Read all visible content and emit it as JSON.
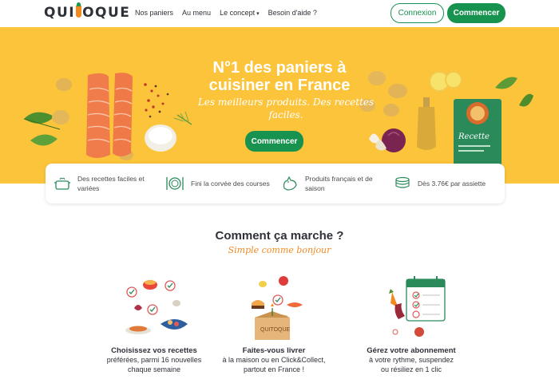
{
  "nav": {
    "logo": "QUITOQUE",
    "links": [
      "Nos paniers",
      "Au menu",
      "Le concept",
      "Besoin d'aide ?"
    ],
    "login_label": "Connexion",
    "start_label": "Commencer"
  },
  "hero": {
    "title_line1": "N°1 des paniers à",
    "title_line2": "cuisiner en France",
    "subtitle": "Les meilleurs produits. Des recettes faciles.",
    "cta_label": "Commencer",
    "recipe_card_label": "Recette"
  },
  "features": [
    {
      "icon": "pot-icon",
      "text": "Des recettes faciles et variées"
    },
    {
      "icon": "plate-cutlery-icon",
      "text": "Fini la corvée des courses"
    },
    {
      "icon": "rooster-icon",
      "text": "Produits français et de saison"
    },
    {
      "icon": "coins-icon",
      "text": "Dès 3.76€ par assiette"
    }
  ],
  "how": {
    "title": "Comment ça marche ?",
    "subtitle": "Simple comme bonjour",
    "steps": [
      {
        "title": "Choisissez vos recettes",
        "desc1": "préférées, parmi 16 nouvelles",
        "desc2": "chaque semaine"
      },
      {
        "title": "Faites-vous livrer",
        "desc1": "à la maison ou en Click&Collect,",
        "desc2": "partout en France !"
      },
      {
        "title": "Gérez votre abonnement",
        "desc1": "à votre rythme, suspendez",
        "desc2": "ou résiliez en 1 clic"
      }
    ]
  },
  "colors": {
    "brand_green": "#17934f",
    "hero_yellow": "#fbc43b",
    "accent_orange": "#f08a24"
  }
}
